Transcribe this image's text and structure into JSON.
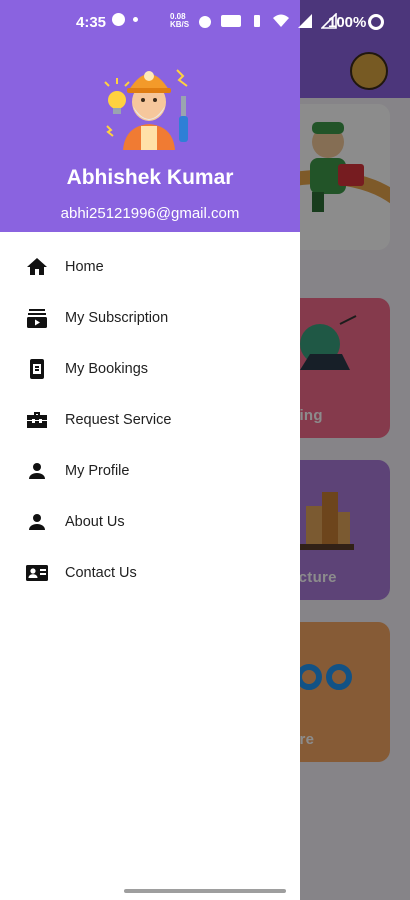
{
  "status_bar": {
    "time": "4:35",
    "speed": "0.08\nKB/S",
    "battery": "100%"
  },
  "drawer": {
    "user_name": "Abhishek Kumar",
    "user_email": "abhi25121996@gmail.com",
    "items": [
      {
        "label": "Home",
        "icon": "home-icon"
      },
      {
        "label": "My Subscription",
        "icon": "subscriptions-icon"
      },
      {
        "label": "My Bookings",
        "icon": "bookings-icon"
      },
      {
        "label": "Request Service",
        "icon": "toolbox-icon"
      },
      {
        "label": "My Profile",
        "icon": "person-icon"
      },
      {
        "label": "About Us",
        "icon": "person-icon"
      },
      {
        "label": "Contact Us",
        "icon": "contact-card-icon"
      }
    ]
  },
  "background": {
    "cards": [
      {
        "label": ""
      },
      {
        "label": "hing"
      },
      {
        "label": "ecture"
      },
      {
        "label": "ore"
      }
    ]
  },
  "colors": {
    "header": "#8a63e0",
    "text": "#1f1f1f"
  }
}
